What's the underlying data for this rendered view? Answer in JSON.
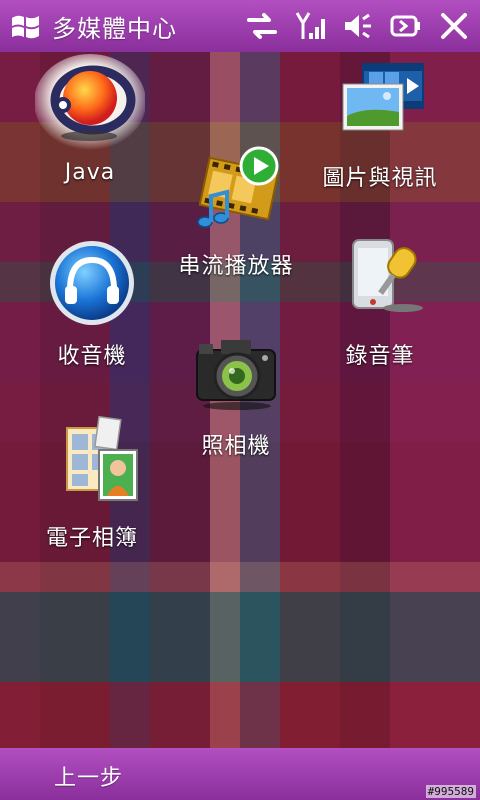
{
  "app": {
    "title": "多媒體中心"
  },
  "statusbar": {
    "icons": [
      "windows-start-icon",
      "data-sync-icon",
      "signal-icon",
      "volume-icon",
      "battery-icon",
      "close-icon"
    ]
  },
  "items": [
    {
      "label": "Java"
    },
    {
      "label": "圖片與視訊"
    },
    {
      "label": "串流播放器"
    },
    {
      "label": "收音機"
    },
    {
      "label": "錄音筆"
    },
    {
      "label": "照相機"
    },
    {
      "label": "電子相簿"
    }
  ],
  "softkeys": {
    "left": "上一步"
  },
  "watermark": "#995589",
  "colors": {
    "bar_top": "#b24fc1",
    "bar_bottom": "#8a2f9c",
    "text": "#ffffff"
  }
}
